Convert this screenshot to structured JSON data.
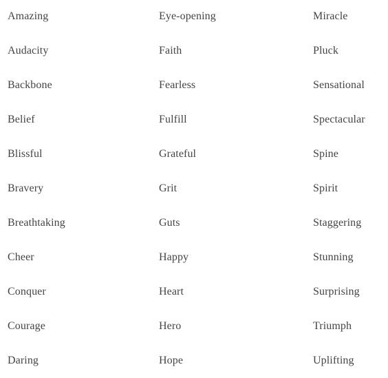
{
  "page": {
    "background_color": "#ffffff",
    "text_color": "#444444"
  },
  "word_list": {
    "columns": [
      {
        "name": "column-1",
        "words": [
          "Amazing",
          "Audacity",
          "Backbone",
          "Belief",
          "Blissful",
          "Bravery",
          "Breathtaking",
          "Cheer",
          "Conquer",
          "Courage",
          "Daring"
        ]
      },
      {
        "name": "column-2",
        "words": [
          "Eye-opening",
          "Faith",
          "Fearless",
          "Fulfill",
          "Grateful",
          "Grit",
          "Guts",
          "Happy",
          "Heart",
          "Hero",
          "Hope"
        ]
      },
      {
        "name": "column-3",
        "words": [
          "Miracle",
          "Pluck",
          "Sensational",
          "Spectacular",
          "Spine",
          "Spirit",
          "Staggering",
          "Stunning",
          "Surprising",
          "Triumph",
          "Uplifting"
        ]
      }
    ]
  }
}
